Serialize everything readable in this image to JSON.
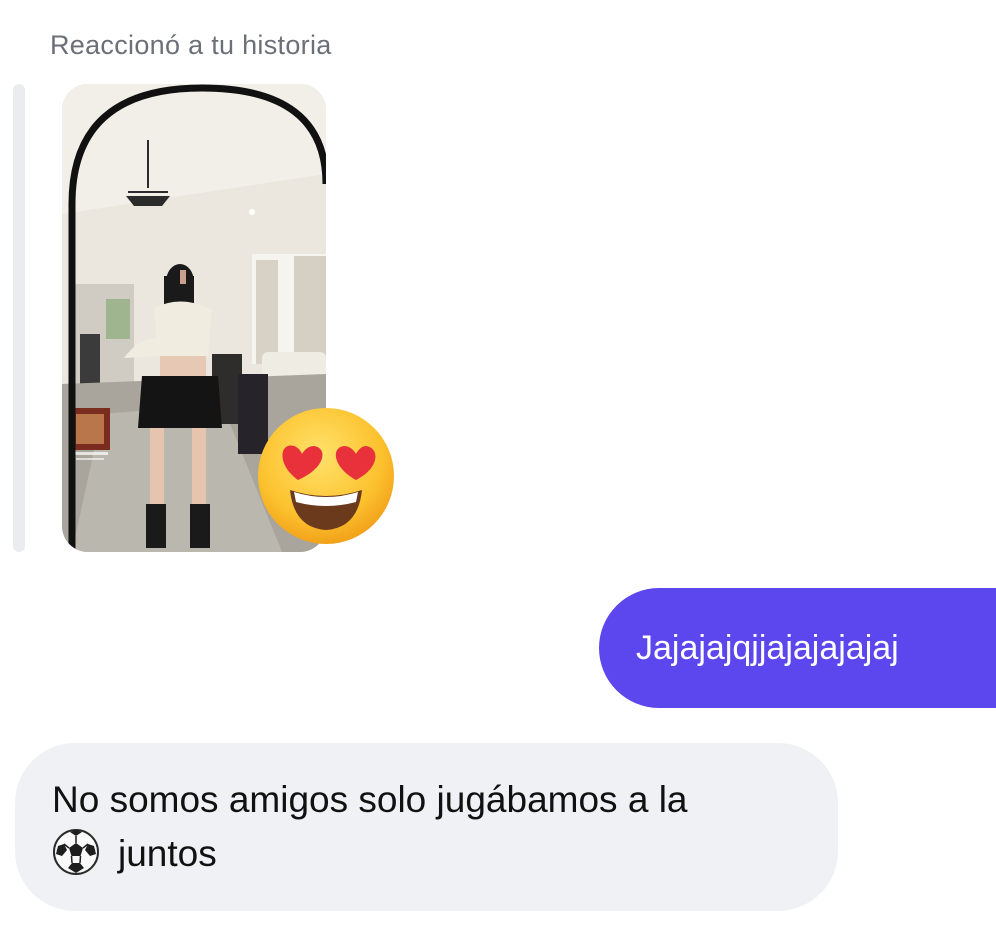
{
  "story_reply": {
    "label": "Reaccionó a tu historia",
    "thumbnail_icon": "story-photo-thumbnail",
    "reaction_icon": "heart-eyes-emoji-icon"
  },
  "messages": [
    {
      "direction": "outgoing",
      "text": "Jajajajqjjajajajajaj",
      "bubble_color": "#5c46ee"
    },
    {
      "direction": "incoming",
      "line1": "No somos amigos solo jugábamos a la",
      "icon": "soccer-ball-icon",
      "line2": "juntos",
      "bubble_color": "#f0f1f4"
    }
  ]
}
